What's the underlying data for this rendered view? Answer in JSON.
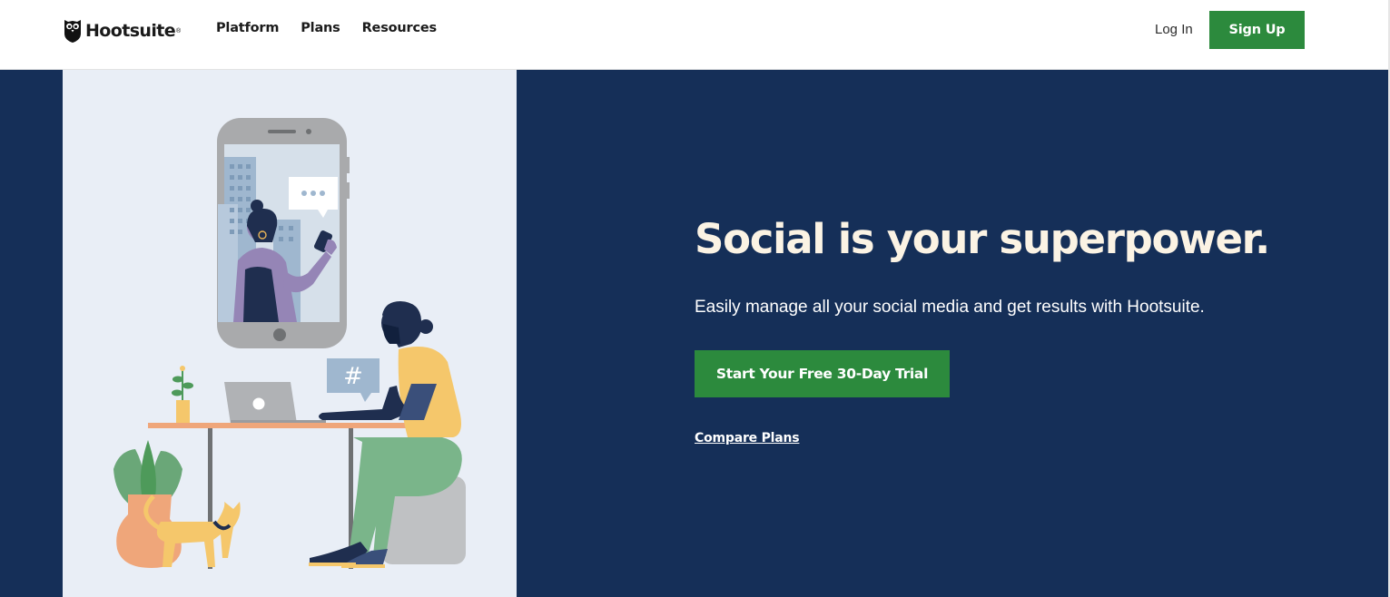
{
  "header": {
    "brand": "Hootsuite",
    "brand_mark": "®",
    "nav": [
      "Platform",
      "Plans",
      "Resources"
    ],
    "login_label": "Log In",
    "signup_label": "Sign Up"
  },
  "hero": {
    "headline": "Social is your superpower.",
    "subline": "Easily manage all your social media and get results with Hootsuite.",
    "cta_label": "Start Your Free 30-Day Trial",
    "compare_label": "Compare Plans",
    "hashtag": "#"
  },
  "colors": {
    "brand_green": "#2c8a3d",
    "hero_navy": "#152f58",
    "illustration_bg": "#e9eef6",
    "headline_cream": "#fbf3e4"
  },
  "icons": [
    "owl-logo-icon",
    "chat-bubble-icon",
    "hashtag-bubble-icon"
  ]
}
